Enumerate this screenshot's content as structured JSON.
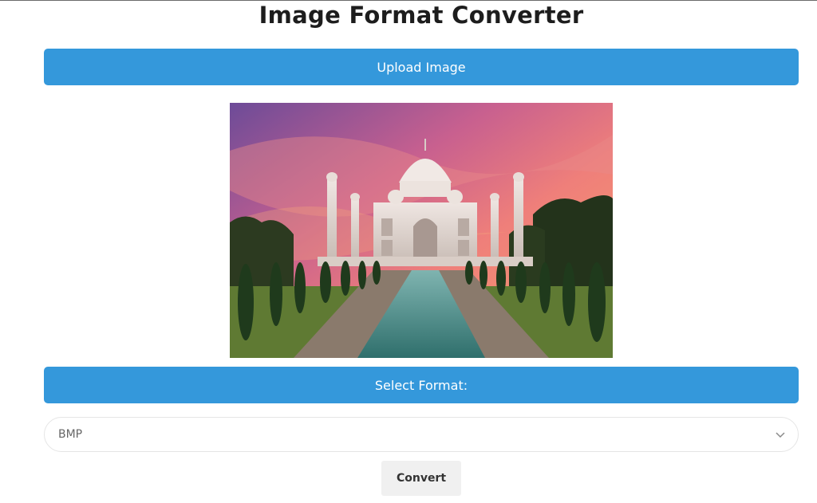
{
  "page": {
    "title": "Image Format Converter"
  },
  "upload": {
    "label": "Upload Image"
  },
  "preview": {
    "icon": "taj-mahal-photo"
  },
  "format": {
    "label": "Select Format:",
    "selected": "BMP"
  },
  "actions": {
    "convert_label": "Convert"
  },
  "colors": {
    "accent": "#3498db",
    "button_bg": "#f0f0f0",
    "title": "#1d1d1d"
  }
}
